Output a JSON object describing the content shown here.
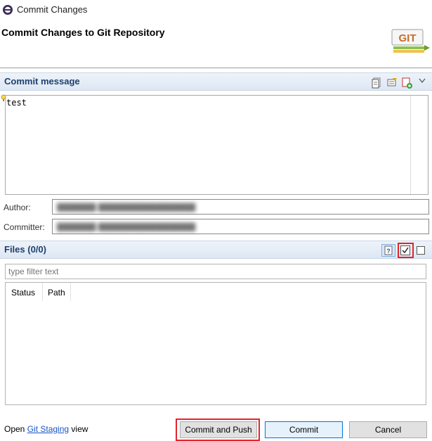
{
  "window": {
    "title": "Commit Changes"
  },
  "header": {
    "title": "Commit Changes to Git Repository",
    "logo_text": "GIT"
  },
  "commit_message": {
    "section_title": "Commit message",
    "text": "test"
  },
  "author": {
    "label": "Author:"
  },
  "committer": {
    "label": "Committer:"
  },
  "files": {
    "section_title": "Files (0/0)",
    "filter_placeholder": "type filter text",
    "columns": [
      "Status",
      "Path"
    ]
  },
  "footer": {
    "open_prefix": "Open",
    "staging_link": "Git Staging",
    "open_suffix": "view"
  },
  "buttons": {
    "commit_and_push": "Commit and Push",
    "commit": "Commit",
    "cancel": "Cancel"
  },
  "colors": {
    "section_title": "#1e3f6e",
    "highlight": "#e3242b",
    "link": "#1a55c8"
  }
}
